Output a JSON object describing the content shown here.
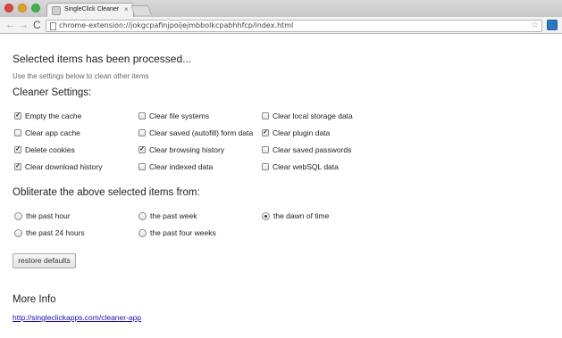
{
  "browser": {
    "tab_title": "SingleClick Cleaner",
    "tab_close": "×",
    "url": "chrome-extension://jokgcpafinjpoijejmbbolkcpabhhfcp/index.html",
    "back": "←",
    "forward": "→",
    "reload": "C",
    "star": "☆"
  },
  "page": {
    "heading": "Selected items has been processed...",
    "subtext": "Use the settings below to clean other items",
    "settings_heading": "Cleaner Settings:",
    "options": [
      {
        "label": "Empty the cache",
        "checked": true
      },
      {
        "label": "Clear file systems",
        "checked": false
      },
      {
        "label": "Clear local storage data",
        "checked": false
      },
      {
        "label": "Clear app cache",
        "checked": false
      },
      {
        "label": "Clear saved (autofill) form data",
        "checked": false
      },
      {
        "label": "Clear plugin data",
        "checked": true
      },
      {
        "label": "Delete cookies",
        "checked": true
      },
      {
        "label": "Clear browsing history",
        "checked": true
      },
      {
        "label": "Clear saved passwords",
        "checked": false
      },
      {
        "label": "Clear download history",
        "checked": true
      },
      {
        "label": "Clear indexed data",
        "checked": false
      },
      {
        "label": "Clear webSQL data",
        "checked": false
      }
    ],
    "check_mark": "✓",
    "obliterate_heading": "Obliterate the above selected items from:",
    "time_ranges": [
      {
        "label": "the past hour",
        "selected": false
      },
      {
        "label": "the past week",
        "selected": false
      },
      {
        "label": "the dawn of time",
        "selected": true
      },
      {
        "label": "the past 24 hours",
        "selected": false
      },
      {
        "label": "the past four weeks",
        "selected": false
      }
    ],
    "restore_label": "restore defaults",
    "more_info_heading": "More Info",
    "more_info_link": "http://singleclickapps.com/cleaner-app"
  }
}
